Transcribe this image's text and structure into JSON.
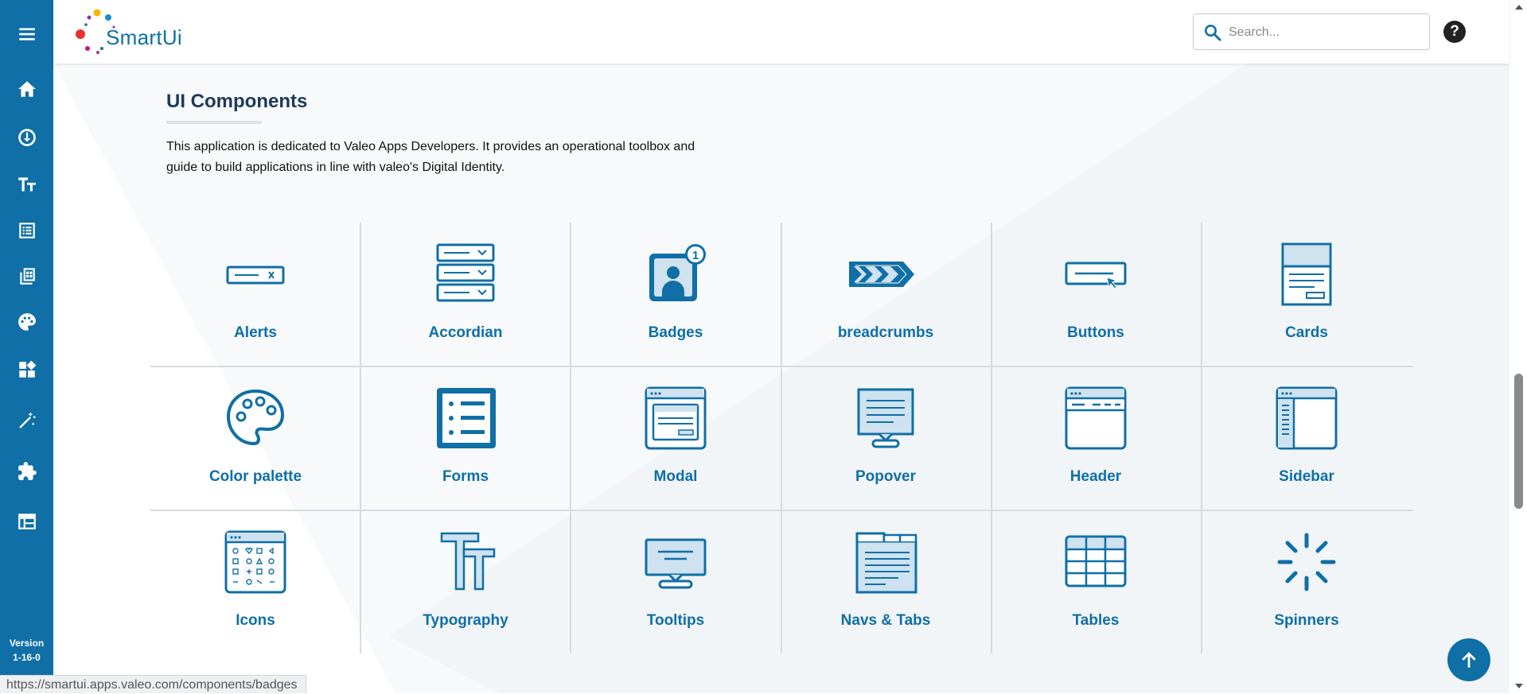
{
  "app": {
    "name": "SmartUi",
    "version_label": "Version",
    "version_value": "1-16-0"
  },
  "sidebar": {
    "items": [
      {
        "icon": "menu-icon"
      },
      {
        "icon": "home-icon"
      },
      {
        "icon": "download-icon"
      },
      {
        "icon": "typography-icon"
      },
      {
        "icon": "list-icon"
      },
      {
        "icon": "grid-icon"
      },
      {
        "icon": "palette-icon"
      },
      {
        "icon": "widgets-icon"
      },
      {
        "icon": "magic-wand-icon"
      },
      {
        "icon": "puzzle-icon"
      },
      {
        "icon": "table-icon"
      }
    ]
  },
  "header": {
    "search_placeholder": "Search...",
    "help_symbol": "?"
  },
  "main": {
    "title": "UI Components",
    "intro": "This application is dedicated to Valeo Apps Developers. It provides an operational toolbox and guide to build applications in line with valeo's Digital Identity.",
    "components": [
      {
        "label": "Alerts",
        "icon": "alert-icon"
      },
      {
        "label": "Accordian",
        "icon": "accordion-icon"
      },
      {
        "label": "Badges",
        "icon": "badge-icon",
        "badge_count": "1"
      },
      {
        "label": "breadcrumbs",
        "icon": "breadcrumbs-icon"
      },
      {
        "label": "Buttons",
        "icon": "button-icon"
      },
      {
        "label": "Cards",
        "icon": "card-icon"
      },
      {
        "label": "Color palette",
        "icon": "palette-icon"
      },
      {
        "label": "Forms",
        "icon": "form-icon"
      },
      {
        "label": "Modal",
        "icon": "modal-icon"
      },
      {
        "label": "Popover",
        "icon": "popover-icon"
      },
      {
        "label": "Header",
        "icon": "header-icon"
      },
      {
        "label": "Sidebar",
        "icon": "sidebar-icon"
      },
      {
        "label": "Icons",
        "icon": "icons-icon"
      },
      {
        "label": "Typography",
        "icon": "typography-icon"
      },
      {
        "label": "Tooltips",
        "icon": "tooltip-icon"
      },
      {
        "label": "Navs & Tabs",
        "icon": "navs-tabs-icon"
      },
      {
        "label": "Tables",
        "icon": "table-icon"
      },
      {
        "label": "Spinners",
        "icon": "spinner-icon"
      }
    ]
  },
  "status_bar": {
    "url": "https://smartui.apps.valeo.com/components/badges"
  },
  "colors": {
    "brand": "#0f6fa6",
    "title": "#1c3a5a"
  }
}
